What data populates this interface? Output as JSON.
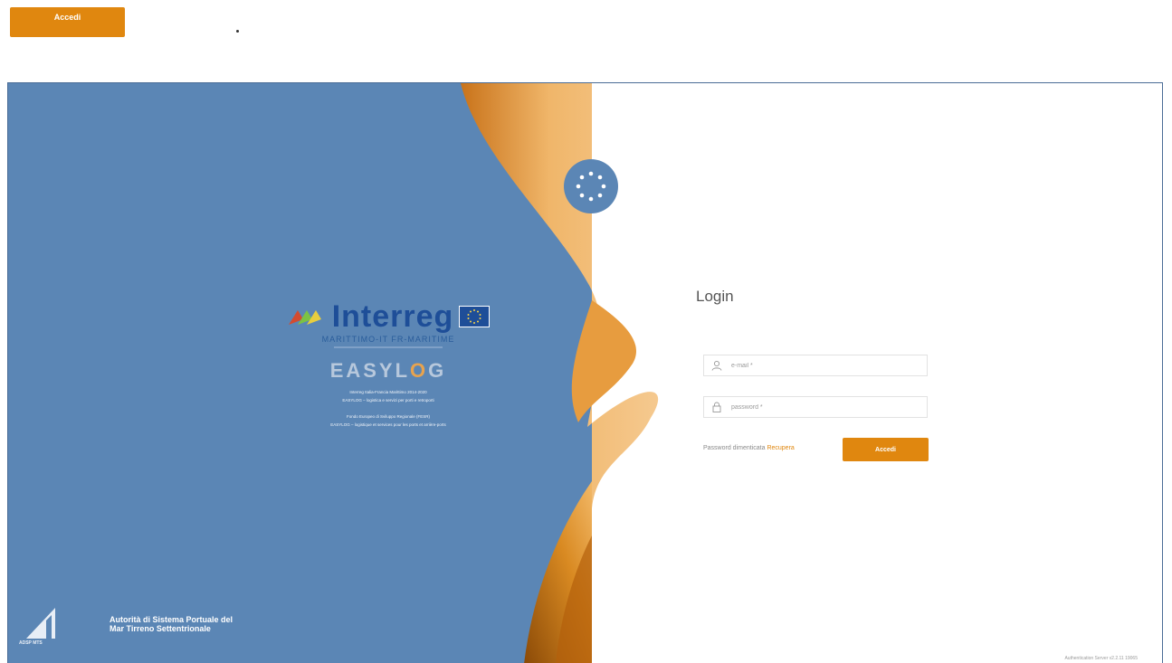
{
  "top": {
    "button_label": "Accedi"
  },
  "brand": {
    "interreg_title": "Interreg",
    "program": "MARITTIMO-IT FR-MARITIME",
    "easylog_prefix": "EASYL",
    "easylog_o": "O",
    "easylog_suffix": "G",
    "desc_lines": [
      "Interreg Italia-Francia Marittimo 2014-2020",
      "EASYLOG – logistica e servizi per porti e retroporti",
      "Fondo Europeo di Sviluppo Regionale (FESR)",
      "EASYLOG – logistique et services pour les ports et arrière-ports"
    ]
  },
  "port": {
    "mark_label": "ADSP MTS",
    "title_line1": "Autorità di Sistema Portuale del",
    "title_line2": "Mar Tirreno Settentrionale"
  },
  "login": {
    "title": "Login",
    "email_placeholder": "e-mail *",
    "password_placeholder": "password *",
    "forgot_text": "Password dimenticata",
    "recover_link": "Recupera",
    "submit_label": "Accedi",
    "version": "Authentication Server v2.2.11 19065"
  },
  "colors": {
    "brand_blue": "#5b86b5",
    "accent_orange": "#e0870f"
  },
  "icons": {
    "user": "user-icon",
    "lock": "lock-icon",
    "logo": "circle-dots-logo",
    "eu": "eu-flag-icon",
    "interreg": "interreg-mark-icon",
    "port_mark": "port-authority-mark-icon"
  }
}
